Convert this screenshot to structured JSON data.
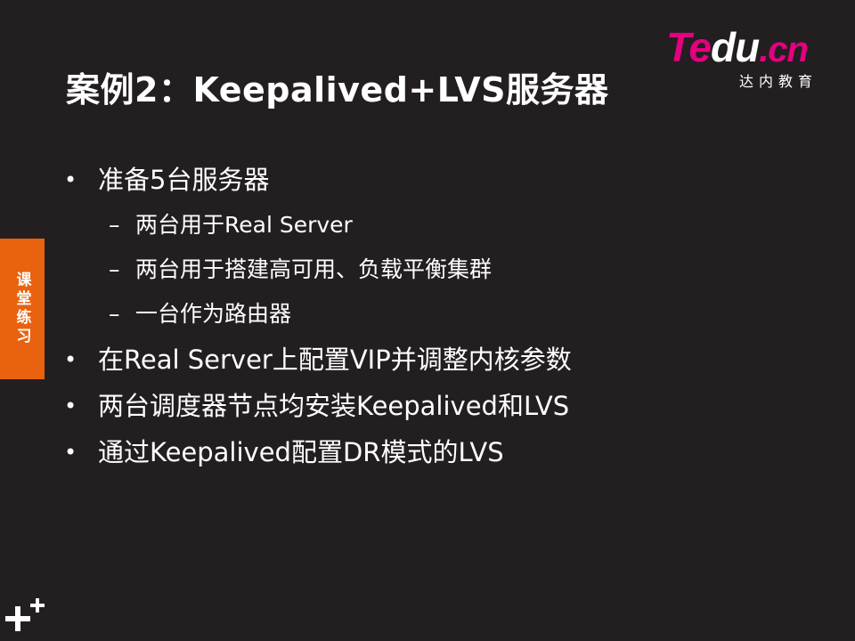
{
  "slide": {
    "title": "案例2：Keepalived+LVS服务器",
    "logo": {
      "wordmark_te": "Te",
      "wordmark_du": "du",
      "wordmark_cn": ".cn",
      "subtitle": "达内教育",
      "accent_color": "#e4007f"
    },
    "side_tab": {
      "label": "课堂练习",
      "color": "#e8620f"
    },
    "bullets": [
      {
        "text": "准备5台服务器",
        "sub": [
          "两台用于Real Server",
          "两台用于搭建高可用、负载平衡集群",
          "一台作为路由器"
        ]
      },
      {
        "text": "在Real Server上配置VIP并调整内核参数",
        "sub": []
      },
      {
        "text": "两台调度器节点均安装Keepalived和LVS",
        "sub": []
      },
      {
        "text": "通过Keepalived配置DR模式的LVS",
        "sub": []
      }
    ],
    "bullet_glyph": "•",
    "dash_glyph": "–",
    "corner_icon": "plus-plus-icon",
    "background_color": "#231f20"
  }
}
